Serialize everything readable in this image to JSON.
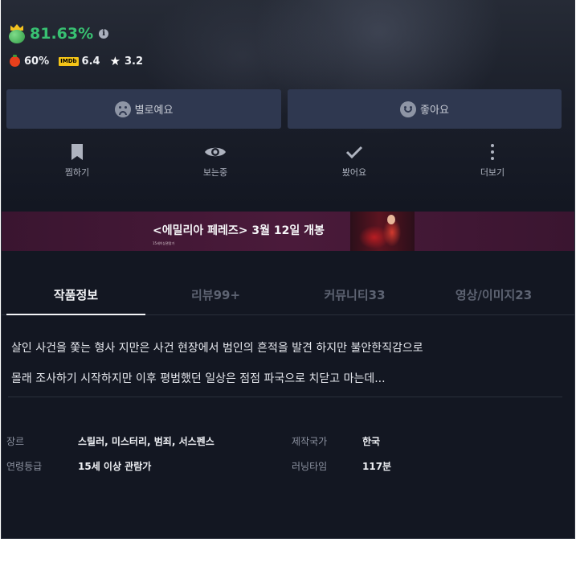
{
  "score": {
    "percent": "81.63%",
    "info_glyph": "i"
  },
  "ratings": {
    "tomato": "60%",
    "imdb_badge": "IMDb",
    "imdb": "6.4",
    "star": "3.2"
  },
  "vote": {
    "dislike_label": "별로예요",
    "like_label": "좋아요"
  },
  "actions": {
    "bookmark": "찜하기",
    "watching": "보는중",
    "watched": "봤어요",
    "more": "더보기"
  },
  "banner": {
    "title": "<에밀리아 페레즈> 3월 12일 개봉",
    "sub": "15세이상관람가"
  },
  "tabs": [
    {
      "label": "작품정보"
    },
    {
      "label": "리뷰99+"
    },
    {
      "label": "커뮤니티33"
    },
    {
      "label": "영상/이미지23"
    }
  ],
  "description": {
    "line1": "살인 사건을 쫓는 형사 지만은 사건 현장에서 범인의 흔적을 발견 하지만 불안한직감으로",
    "line2": "몰래 조사하기 시작하지만 이후 평범했던 일상은 점점 파국으로 치닫고 마는데..."
  },
  "meta": {
    "genre_label": "장르",
    "genre_value": "스릴러, 미스터리, 범죄, 서스펜스",
    "country_label": "제작국가",
    "country_value": "한국",
    "rating_label": "연령등급",
    "rating_value": "15세 이상 관람가",
    "runtime_label": "러닝타임",
    "runtime_value": "117분"
  },
  "colors": {
    "accent_green": "#38c172",
    "button_bg": "#2f3850",
    "page_bg": "#131722"
  }
}
